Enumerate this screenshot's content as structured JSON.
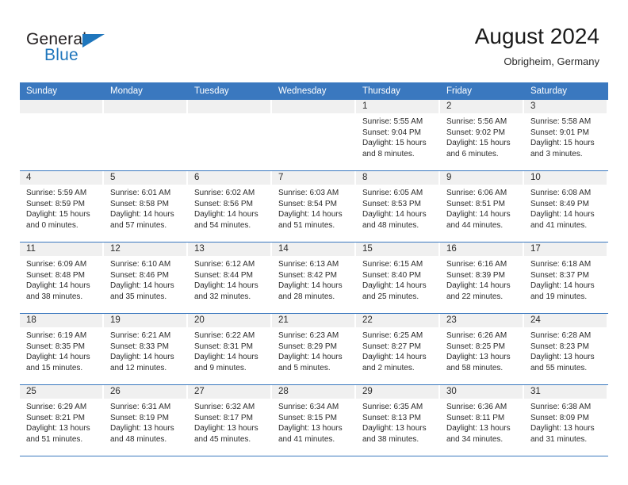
{
  "brand": {
    "name_top": "General",
    "name_bottom": "Blue",
    "accent_color": "#1f76bc"
  },
  "header": {
    "title": "August 2024",
    "location": "Obrigheim, Germany"
  },
  "theme": {
    "header_blue": "#3a78bf",
    "day_band_gray": "#f0f0f0",
    "text_color": "#2b2b2b"
  },
  "calendar": {
    "weekday_headers": [
      "Sunday",
      "Monday",
      "Tuesday",
      "Wednesday",
      "Thursday",
      "Friday",
      "Saturday"
    ],
    "weeks": [
      [
        {
          "day": "",
          "empty": true
        },
        {
          "day": "",
          "empty": true
        },
        {
          "day": "",
          "empty": true
        },
        {
          "day": "",
          "empty": true
        },
        {
          "day": "1",
          "sunrise": "Sunrise: 5:55 AM",
          "sunset": "Sunset: 9:04 PM",
          "daylight": "Daylight: 15 hours and 8 minutes."
        },
        {
          "day": "2",
          "sunrise": "Sunrise: 5:56 AM",
          "sunset": "Sunset: 9:02 PM",
          "daylight": "Daylight: 15 hours and 6 minutes."
        },
        {
          "day": "3",
          "sunrise": "Sunrise: 5:58 AM",
          "sunset": "Sunset: 9:01 PM",
          "daylight": "Daylight: 15 hours and 3 minutes."
        }
      ],
      [
        {
          "day": "4",
          "sunrise": "Sunrise: 5:59 AM",
          "sunset": "Sunset: 8:59 PM",
          "daylight": "Daylight: 15 hours and 0 minutes."
        },
        {
          "day": "5",
          "sunrise": "Sunrise: 6:01 AM",
          "sunset": "Sunset: 8:58 PM",
          "daylight": "Daylight: 14 hours and 57 minutes."
        },
        {
          "day": "6",
          "sunrise": "Sunrise: 6:02 AM",
          "sunset": "Sunset: 8:56 PM",
          "daylight": "Daylight: 14 hours and 54 minutes."
        },
        {
          "day": "7",
          "sunrise": "Sunrise: 6:03 AM",
          "sunset": "Sunset: 8:54 PM",
          "daylight": "Daylight: 14 hours and 51 minutes."
        },
        {
          "day": "8",
          "sunrise": "Sunrise: 6:05 AM",
          "sunset": "Sunset: 8:53 PM",
          "daylight": "Daylight: 14 hours and 48 minutes."
        },
        {
          "day": "9",
          "sunrise": "Sunrise: 6:06 AM",
          "sunset": "Sunset: 8:51 PM",
          "daylight": "Daylight: 14 hours and 44 minutes."
        },
        {
          "day": "10",
          "sunrise": "Sunrise: 6:08 AM",
          "sunset": "Sunset: 8:49 PM",
          "daylight": "Daylight: 14 hours and 41 minutes."
        }
      ],
      [
        {
          "day": "11",
          "sunrise": "Sunrise: 6:09 AM",
          "sunset": "Sunset: 8:48 PM",
          "daylight": "Daylight: 14 hours and 38 minutes."
        },
        {
          "day": "12",
          "sunrise": "Sunrise: 6:10 AM",
          "sunset": "Sunset: 8:46 PM",
          "daylight": "Daylight: 14 hours and 35 minutes."
        },
        {
          "day": "13",
          "sunrise": "Sunrise: 6:12 AM",
          "sunset": "Sunset: 8:44 PM",
          "daylight": "Daylight: 14 hours and 32 minutes."
        },
        {
          "day": "14",
          "sunrise": "Sunrise: 6:13 AM",
          "sunset": "Sunset: 8:42 PM",
          "daylight": "Daylight: 14 hours and 28 minutes."
        },
        {
          "day": "15",
          "sunrise": "Sunrise: 6:15 AM",
          "sunset": "Sunset: 8:40 PM",
          "daylight": "Daylight: 14 hours and 25 minutes."
        },
        {
          "day": "16",
          "sunrise": "Sunrise: 6:16 AM",
          "sunset": "Sunset: 8:39 PM",
          "daylight": "Daylight: 14 hours and 22 minutes."
        },
        {
          "day": "17",
          "sunrise": "Sunrise: 6:18 AM",
          "sunset": "Sunset: 8:37 PM",
          "daylight": "Daylight: 14 hours and 19 minutes."
        }
      ],
      [
        {
          "day": "18",
          "sunrise": "Sunrise: 6:19 AM",
          "sunset": "Sunset: 8:35 PM",
          "daylight": "Daylight: 14 hours and 15 minutes."
        },
        {
          "day": "19",
          "sunrise": "Sunrise: 6:21 AM",
          "sunset": "Sunset: 8:33 PM",
          "daylight": "Daylight: 14 hours and 12 minutes."
        },
        {
          "day": "20",
          "sunrise": "Sunrise: 6:22 AM",
          "sunset": "Sunset: 8:31 PM",
          "daylight": "Daylight: 14 hours and 9 minutes."
        },
        {
          "day": "21",
          "sunrise": "Sunrise: 6:23 AM",
          "sunset": "Sunset: 8:29 PM",
          "daylight": "Daylight: 14 hours and 5 minutes."
        },
        {
          "day": "22",
          "sunrise": "Sunrise: 6:25 AM",
          "sunset": "Sunset: 8:27 PM",
          "daylight": "Daylight: 14 hours and 2 minutes."
        },
        {
          "day": "23",
          "sunrise": "Sunrise: 6:26 AM",
          "sunset": "Sunset: 8:25 PM",
          "daylight": "Daylight: 13 hours and 58 minutes."
        },
        {
          "day": "24",
          "sunrise": "Sunrise: 6:28 AM",
          "sunset": "Sunset: 8:23 PM",
          "daylight": "Daylight: 13 hours and 55 minutes."
        }
      ],
      [
        {
          "day": "25",
          "sunrise": "Sunrise: 6:29 AM",
          "sunset": "Sunset: 8:21 PM",
          "daylight": "Daylight: 13 hours and 51 minutes."
        },
        {
          "day": "26",
          "sunrise": "Sunrise: 6:31 AM",
          "sunset": "Sunset: 8:19 PM",
          "daylight": "Daylight: 13 hours and 48 minutes."
        },
        {
          "day": "27",
          "sunrise": "Sunrise: 6:32 AM",
          "sunset": "Sunset: 8:17 PM",
          "daylight": "Daylight: 13 hours and 45 minutes."
        },
        {
          "day": "28",
          "sunrise": "Sunrise: 6:34 AM",
          "sunset": "Sunset: 8:15 PM",
          "daylight": "Daylight: 13 hours and 41 minutes."
        },
        {
          "day": "29",
          "sunrise": "Sunrise: 6:35 AM",
          "sunset": "Sunset: 8:13 PM",
          "daylight": "Daylight: 13 hours and 38 minutes."
        },
        {
          "day": "30",
          "sunrise": "Sunrise: 6:36 AM",
          "sunset": "Sunset: 8:11 PM",
          "daylight": "Daylight: 13 hours and 34 minutes."
        },
        {
          "day": "31",
          "sunrise": "Sunrise: 6:38 AM",
          "sunset": "Sunset: 8:09 PM",
          "daylight": "Daylight: 13 hours and 31 minutes."
        }
      ]
    ]
  }
}
